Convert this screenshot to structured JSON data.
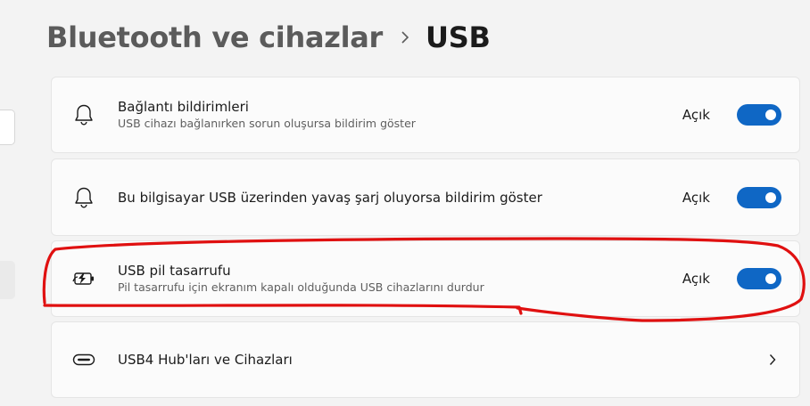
{
  "breadcrumb": {
    "parent": "Bluetooth ve cihazlar",
    "current": "USB"
  },
  "settings": [
    {
      "icon": "bell-icon",
      "title": "Bağlantı bildirimleri",
      "subtitle": "USB cihazı bağlanırken sorun oluşursa bildirim göster",
      "state_label": "Açık",
      "toggle_on": true
    },
    {
      "icon": "bell-icon",
      "title": "Bu bilgisayar USB üzerinden yavaş şarj oluyorsa bildirim göster",
      "state_label": "Açık",
      "toggle_on": true
    },
    {
      "icon": "battery-saver-icon",
      "title": "USB pil tasarrufu",
      "subtitle": "Pil tasarrufu için ekranım kapalı olduğunda USB cihazlarını durdur",
      "state_label": "Açık",
      "toggle_on": true
    },
    {
      "icon": "usb-c-port-icon",
      "title": "USB4 Hub'ları ve Cihazları"
    }
  ],
  "colors": {
    "background": "#f3f3f3",
    "card": "#fbfbfb",
    "accent": "#0f67c5",
    "annotation": "#e01010"
  }
}
